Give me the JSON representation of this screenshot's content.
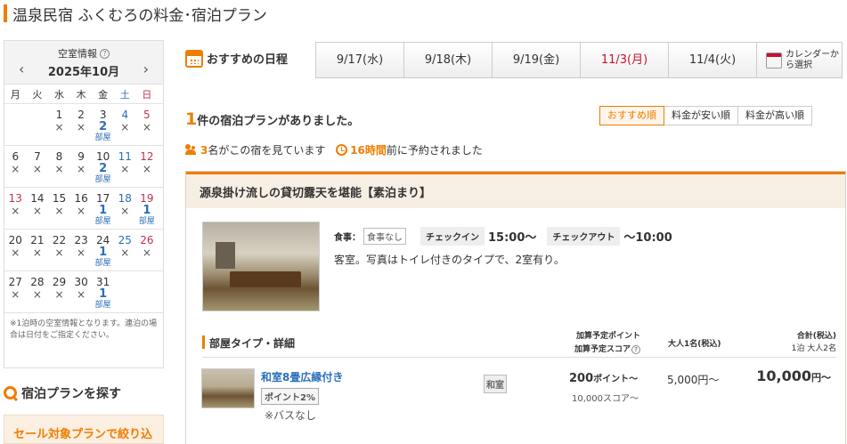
{
  "page_title": "温泉民宿 ふくむろの料金･宿泊プラン",
  "calendar": {
    "title": "空室情報",
    "month": "2025年10月",
    "dow": [
      "月",
      "火",
      "水",
      "木",
      "金",
      "土",
      "日"
    ],
    "weeks": [
      [
        {
          "day": "",
          "status": ""
        },
        {
          "day": "",
          "status": ""
        },
        {
          "day": "1",
          "status": "×"
        },
        {
          "day": "2",
          "status": "×"
        },
        {
          "day": "3",
          "status": "2",
          "unit": "部屋"
        },
        {
          "day": "4",
          "status": "×"
        },
        {
          "day": "5",
          "status": "×"
        }
      ],
      [
        {
          "day": "6",
          "status": "×"
        },
        {
          "day": "7",
          "status": "×"
        },
        {
          "day": "8",
          "status": "×"
        },
        {
          "day": "9",
          "status": "×"
        },
        {
          "day": "10",
          "status": "2",
          "unit": "部屋"
        },
        {
          "day": "11",
          "status": "×"
        },
        {
          "day": "12",
          "status": "×"
        }
      ],
      [
        {
          "day": "13",
          "status": "×"
        },
        {
          "day": "14",
          "status": "×"
        },
        {
          "day": "15",
          "status": "×"
        },
        {
          "day": "16",
          "status": "×"
        },
        {
          "day": "17",
          "status": "1",
          "unit": "部屋"
        },
        {
          "day": "18",
          "status": "×"
        },
        {
          "day": "19",
          "status": "1",
          "unit": "部屋"
        }
      ],
      [
        {
          "day": "20",
          "status": "×"
        },
        {
          "day": "21",
          "status": "×"
        },
        {
          "day": "22",
          "status": "×"
        },
        {
          "day": "23",
          "status": "×"
        },
        {
          "day": "24",
          "status": "1",
          "unit": "部屋"
        },
        {
          "day": "25",
          "status": "×"
        },
        {
          "day": "26",
          "status": "×"
        }
      ],
      [
        {
          "day": "27",
          "status": "×"
        },
        {
          "day": "28",
          "status": "×"
        },
        {
          "day": "29",
          "status": "×"
        },
        {
          "day": "30",
          "status": "×"
        },
        {
          "day": "31",
          "status": "1",
          "unit": "部屋"
        },
        {
          "day": "",
          "status": ""
        },
        {
          "day": "",
          "status": ""
        }
      ]
    ],
    "holiday_dates": [
      "13"
    ],
    "note": "※1泊時の空室情報となります。連泊の場合は日付をご指定ください。"
  },
  "sidebar": {
    "search_title": "宿泊プランを探す",
    "sale_filter": "セール対象プランで絞り込む"
  },
  "schedule": {
    "label": "おすすめの日程",
    "dates": [
      {
        "label": "9/17(水)",
        "holiday": false
      },
      {
        "label": "9/18(木)",
        "holiday": false
      },
      {
        "label": "9/19(金)",
        "holiday": false
      },
      {
        "label": "11/3(月)",
        "holiday": true
      },
      {
        "label": "11/4(火)",
        "holiday": false
      }
    ],
    "calendar_select": "カレンダーから選択"
  },
  "results": {
    "count": "1",
    "count_suffix": "件の宿泊プランがありました。",
    "sort_options": [
      "おすすめ順",
      "料金が安い順",
      "料金が高い順"
    ],
    "viewers_count": "3",
    "viewers_text": "名がこの宿を見ています",
    "last_booking": "16時間",
    "last_booking_text": "前に予約されました"
  },
  "plan": {
    "name": "源泉掛け流しの貸切露天を堪能【素泊まり】",
    "meal_label": "食事：",
    "meal_value": "食事なし",
    "checkin_label": "チェックイン",
    "checkin_value": "15:00〜",
    "checkout_label": "チェックアウト",
    "checkout_value": "〜10:00",
    "description": "客室。写真はトイレ付きのタイプで、2室有り。",
    "room_header": "部屋タイプ・詳細",
    "col_points_1": "加算予定ポイント",
    "col_points_2": "加算予定スコア",
    "col_adult": "大人1名(税込)",
    "col_total_1": "合計(税込)",
    "col_total_2": "1泊 大人2名",
    "room": {
      "name": "和室8畳広縁付き",
      "points_badge": "ポイント2%",
      "note": "※バスなし",
      "type_tag": "和室",
      "points": "200",
      "points_unit": "ポイント〜",
      "score": "10,000スコア〜",
      "adult_price": "5,000円〜",
      "total_price": "10,000",
      "total_unit": "円〜"
    }
  },
  "colors": {
    "accent": "#ef7d00",
    "link": "#2a6ebb",
    "holiday": "#c8102e"
  }
}
